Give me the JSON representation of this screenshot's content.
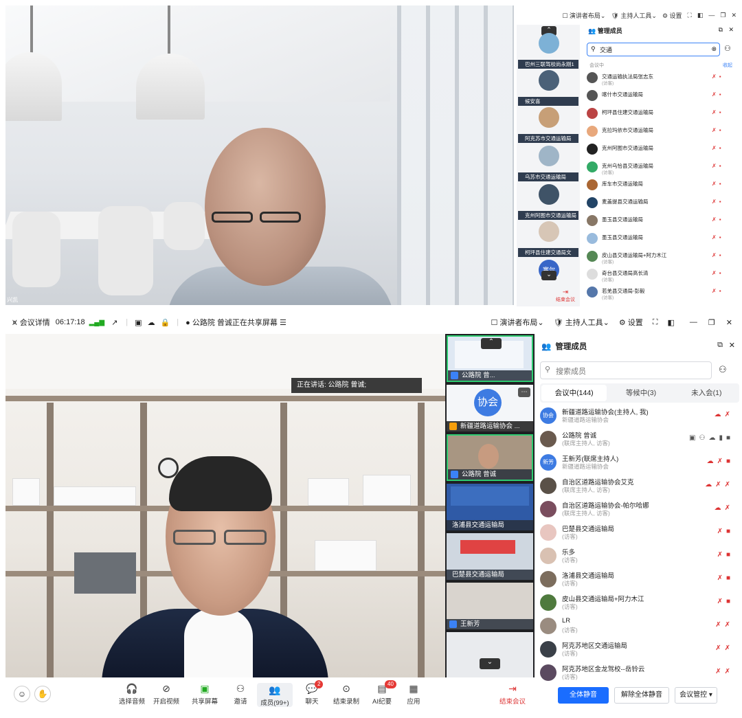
{
  "top": {
    "video_label": "兴凯",
    "toolbar": {
      "layout": "演讲者布局",
      "host_tools": "主持人工具",
      "settings": "设置"
    },
    "panel_title": "管理成员",
    "search_value": "交通",
    "in_meeting": "会议中",
    "collapse": "收起",
    "leave": "结束会议",
    "thumbs": [
      {
        "label": "巴州三联驾校尚永刚1"
      },
      {
        "label": "候安喜"
      },
      {
        "label": "阿克苏市交通运输局"
      },
      {
        "label": "乌苏市交通运输局"
      },
      {
        "label": "克州阿图市交通运输局"
      },
      {
        "label": "柯坪县住建交通局文"
      },
      {
        "label": "塞尔"
      }
    ],
    "members": [
      {
        "name": "交通运输执法局张志东",
        "sub": "(访客)"
      },
      {
        "name": "喀什市交通运输局",
        "sub": ""
      },
      {
        "name": "柯坪县住建交通运输局",
        "sub": ""
      },
      {
        "name": "克拉玛依市交通运输局",
        "sub": ""
      },
      {
        "name": "克州阿图市交通运输局",
        "sub": ""
      },
      {
        "name": "克州乌恰县交通运输局",
        "sub": "(访客)"
      },
      {
        "name": "库车市交通运输局",
        "sub": ""
      },
      {
        "name": "麦盖提县交通运输局",
        "sub": ""
      },
      {
        "name": "墨玉县交通运输局",
        "sub": ""
      },
      {
        "name": "墨玉县交通运输局",
        "sub": ""
      },
      {
        "name": "皮山县交通运输局+阿力木江",
        "sub": "(访客)"
      },
      {
        "name": "奇台县交通局高长清",
        "sub": "(访客)"
      },
      {
        "name": "若羌县交通局-彭毅",
        "sub": "(访客)"
      }
    ]
  },
  "bottom": {
    "toolbar": {
      "details": "会议详情",
      "time": "06:17:18",
      "sharing": "公路院 曾诚正在共享屏幕",
      "layout": "演讲者布局",
      "host_tools": "主持人工具",
      "settings": "设置"
    },
    "speaking": "正在讲话:  公路院 曾诚;",
    "thumbs": [
      {
        "label": "公路院 曾..."
      },
      {
        "label": "新疆道路运输协会 ..."
      },
      {
        "label": "公路院 曾诚"
      },
      {
        "label": "洛浦县交通运输局"
      },
      {
        "label": "巴楚县交通运输局"
      },
      {
        "label": "王新芳"
      }
    ],
    "thumb_avatar": "协会",
    "panel": {
      "title": "管理成员",
      "search_placeholder": "搜索成员",
      "tabs": [
        "会议中(144)",
        "等候中(3)",
        "未入会(1)"
      ],
      "members": [
        {
          "avatar": "协会",
          "name": "新疆道路运输协会(主持人, 我)",
          "sub": "新疆道路运输协会"
        },
        {
          "avatar": "",
          "name": "公路院 曾诚",
          "sub": "(联席主持人, 访客)"
        },
        {
          "avatar": "新芳",
          "name": "王新芳(联席主持人)",
          "sub": "新疆道路运输协会"
        },
        {
          "avatar": "",
          "name": "自治区道路运输协会艾克",
          "sub": "(联席主持人, 访客)"
        },
        {
          "avatar": "",
          "name": "自治区道路运输协会-帕尔哈娜",
          "sub": "(联席主持人, 访客)"
        },
        {
          "avatar": "",
          "name": "巴楚县交通运输局",
          "sub": "(访客)"
        },
        {
          "avatar": "",
          "name": "乐多",
          "sub": "(访客)"
        },
        {
          "avatar": "",
          "name": "洛浦县交通运输局",
          "sub": "(访客)"
        },
        {
          "avatar": "",
          "name": "皮山县交通运输局+阿力木江",
          "sub": "(访客)"
        },
        {
          "avatar": "",
          "name": "LR",
          "sub": "(访客)"
        },
        {
          "avatar": "",
          "name": "阿克苏地区交通运输局",
          "sub": "(访客)"
        },
        {
          "avatar": "",
          "name": "阿克苏地区金龙驾校--岳铃云",
          "sub": "(访客)"
        }
      ],
      "mute_all": "全体静音",
      "unmute_all": "解除全体静音",
      "meeting_control": "会议管控"
    },
    "bottombar": [
      {
        "label": "选择音频",
        "icon": "headset-icon"
      },
      {
        "label": "开启视频",
        "icon": "video-off-icon"
      },
      {
        "label": "共享屏幕",
        "icon": "share-screen-icon"
      },
      {
        "label": "邀请",
        "icon": "invite-icon"
      },
      {
        "label": "成员(99+)",
        "icon": "members-icon"
      },
      {
        "label": "聊天",
        "icon": "chat-icon",
        "badge": "2"
      },
      {
        "label": "结束录制",
        "icon": "record-icon"
      },
      {
        "label": "AI纪要",
        "icon": "ai-notes-icon",
        "badge": "40"
      },
      {
        "label": "应用",
        "icon": "apps-icon"
      }
    ],
    "leave": "结束会议"
  }
}
